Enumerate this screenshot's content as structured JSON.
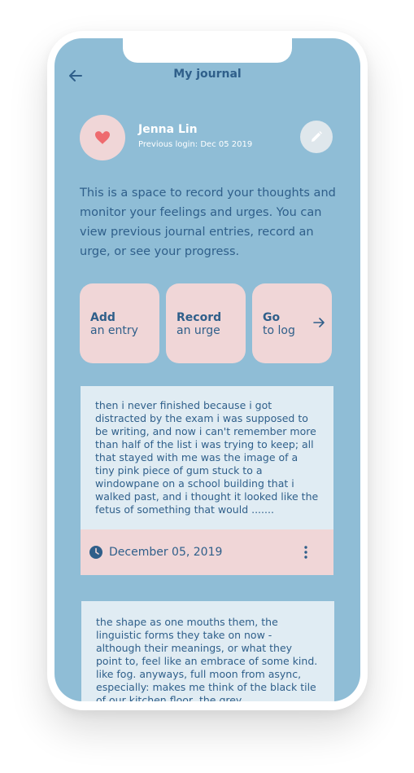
{
  "header": {
    "title": "My journal"
  },
  "profile": {
    "name": "Jenna Lin",
    "last_login": "Previous login: Dec 05 2019"
  },
  "intro_text": "This is a space to record your thoughts and monitor your feelings and urges. You can view previous journal entries, record an urge, or see your progress.",
  "actions": [
    {
      "line1": "Add",
      "line2": "an entry"
    },
    {
      "line1": "Record",
      "line2": "an urge"
    },
    {
      "line1": "Go",
      "line2": "to log"
    }
  ],
  "entries": [
    {
      "text": "then i never finished because i got distracted by the exam i was supposed to be writing, and now i can't remember more than half of the list i was trying to keep; all that stayed with me was the image of a tiny pink piece of gum stuck to a windowpane on a school building that i walked past, and i thought it looked like the fetus of something that would .......",
      "date": "December 05, 2019"
    },
    {
      "text": "the shape as one mouths them, the linguistic forms they take on now - although their meanings, or what they point to, feel like an embrace of some kind. like fog. anyways, full moon from async, especially: makes me think of the black tile of our kitchen floor, the grey"
    }
  ],
  "colors": {
    "screen_bg": "#8fbdd6",
    "accent_text": "#2f5f8a",
    "card_pink": "#f0d6d7",
    "heart": "#ee6b6f",
    "entry_bg": "#e0ecf3"
  },
  "icons": {
    "back": "arrow-left-icon",
    "avatar": "heart-icon",
    "edit": "pencil-icon",
    "go": "arrow-right-icon",
    "date": "clock-icon",
    "menu": "more-vertical-icon"
  }
}
